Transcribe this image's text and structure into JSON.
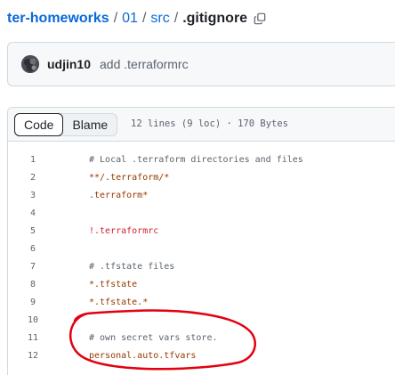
{
  "breadcrumb": {
    "repo": "ter-homeworks",
    "sep": "/",
    "folder1": "01",
    "folder2": "src",
    "file": ".gitignore"
  },
  "commit": {
    "author": "udjin10",
    "message": "add .terraformrc"
  },
  "file_header": {
    "tabs": [
      "Code",
      "Blame"
    ],
    "meta": "12 lines (9 loc) · 170 Bytes"
  },
  "code": {
    "lines": [
      {
        "n": "1",
        "text": "# Local .terraform directories and files",
        "kind": "comment"
      },
      {
        "n": "2",
        "text": "**/.terraform/*",
        "kind": "string"
      },
      {
        "n": "3",
        "text": ".terraform*",
        "kind": "string"
      },
      {
        "n": "4",
        "text": "",
        "kind": "plain"
      },
      {
        "n": "5",
        "text": "!.terraformrc",
        "kind": "neg"
      },
      {
        "n": "6",
        "text": "",
        "kind": "plain"
      },
      {
        "n": "7",
        "text": "# .tfstate files",
        "kind": "comment"
      },
      {
        "n": "8",
        "text": "*.tfstate",
        "kind": "string"
      },
      {
        "n": "9",
        "text": "*.tfstate.*",
        "kind": "string"
      },
      {
        "n": "10",
        "text": "",
        "kind": "plain"
      },
      {
        "n": "11",
        "text": "# own secret vars store.",
        "kind": "comment"
      },
      {
        "n": "12",
        "text": "personal.auto.tfvars",
        "kind": "string"
      }
    ]
  },
  "colors": {
    "link": "#0969da",
    "annotation": "#e3000f"
  }
}
